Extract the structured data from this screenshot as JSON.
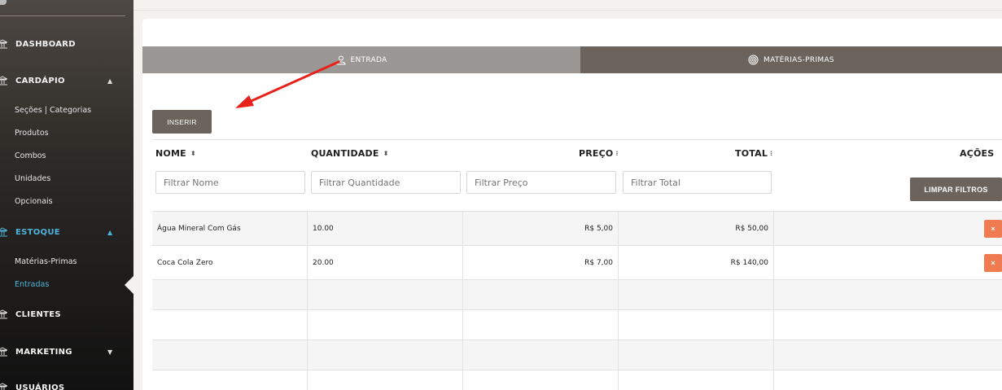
{
  "sidebar": {
    "items": [
      {
        "label": "DASHBOARD",
        "icon": "bank-icon"
      },
      {
        "label": "CARDÁPIO",
        "icon": "bank-icon",
        "caret": "▲"
      },
      {
        "label": "ESTOQUE",
        "icon": "bank-icon",
        "caret": "▲"
      },
      {
        "label": "CLIENTES",
        "icon": "bank-icon"
      },
      {
        "label": "MARKETING",
        "icon": "bank-icon",
        "caret": "▼"
      },
      {
        "label": "USUÁRIOS",
        "icon": "bank-icon"
      }
    ],
    "cardapio_sub": [
      "Seções | Categorias",
      "Produtos",
      "Combos",
      "Unidades",
      "Opcionais"
    ],
    "estoque_sub": [
      "Matérias-Primas",
      "Entradas"
    ]
  },
  "tabs": {
    "entrada": "ENTRADA",
    "materias": "MATÉRIAS-PRIMAS"
  },
  "actions": {
    "inserir": "INSERIR",
    "limpar_filtros": "LIMPAR FILTROS"
  },
  "table": {
    "headers": {
      "nome": "NOME",
      "quantidade": "QUANTIDADE",
      "preco": "PREÇO",
      "total": "TOTAL",
      "acoes": "AÇÕES"
    },
    "filters": {
      "nome": "Filtrar Nome",
      "quantidade": "Filtrar Quantidade",
      "preco": "Filtrar Preço",
      "total": "Filtrar Total"
    },
    "rows": [
      {
        "nome": "Água Mineral Com Gás",
        "quantidade": "10.00",
        "preco": "R$ 5,00",
        "total": "R$ 50,00",
        "delete": "×"
      },
      {
        "nome": "Coca Cola Zero",
        "quantidade": "20.00",
        "preco": "R$ 7,00",
        "total": "R$ 140,00",
        "delete": "×"
      }
    ]
  },
  "colors": {
    "accent": "#4fb3d9",
    "button": "#6b635c",
    "delete": "#f07b50",
    "annotation_arrow": "#e8221b"
  }
}
